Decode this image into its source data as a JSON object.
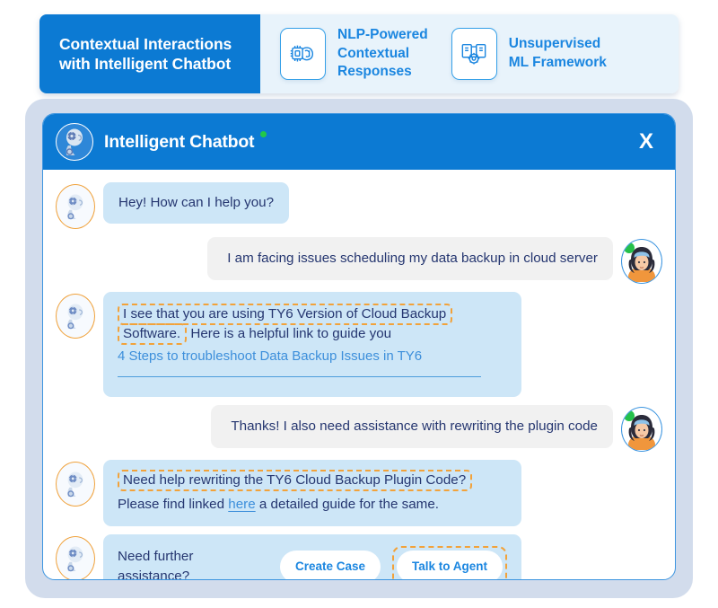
{
  "banner": {
    "title": "Contextual\nInteractions with\nIntelligent Chatbot",
    "features": [
      {
        "icon": "ai-chip-brain-icon",
        "label": "NLP-Powered\nContextual\nResponses"
      },
      {
        "icon": "ml-gear-framework-icon",
        "label": "Unsupervised\nML Framework"
      }
    ]
  },
  "chat": {
    "header": {
      "avatar": "robot-head-icon",
      "title": "Intelligent Chatbot",
      "status": "online",
      "close_label": "X"
    },
    "messages": [
      {
        "id": "m1",
        "sender": "bot",
        "text": "Hey! How can I help you?"
      },
      {
        "id": "m2",
        "sender": "user",
        "text": "I am facing issues scheduling my data backup in cloud server"
      },
      {
        "id": "m3",
        "sender": "bot",
        "highlight": "I see that you are using TY6 Version of Cloud Backup Software.",
        "text": " Here is a helpful link to guide you",
        "link": "4 Steps to troubleshoot Data Backup Issues in TY6"
      },
      {
        "id": "m4",
        "sender": "user",
        "text": "Thanks! I also need assistance with rewriting the plugin code"
      },
      {
        "id": "m5",
        "sender": "bot",
        "highlight": "Need help rewriting the TY6 Cloud Backup Plugin Code?",
        "text_before": "Please find linked ",
        "inline_link": "here",
        "text_after": " a detailed guide for the same."
      },
      {
        "id": "m6",
        "sender": "bot",
        "text": "Need further assistance?",
        "buttons": [
          {
            "label": "Create Case",
            "highlighted": false
          },
          {
            "label": "Talk to Agent",
            "highlighted": true
          }
        ]
      }
    ]
  },
  "colors": {
    "brand_blue": "#0c7ad3",
    "accent_blue": "#1b86e0",
    "bot_bubble": "#cde6f7",
    "user_bubble": "#f1f1f1",
    "text_navy": "#253670",
    "highlight_orange": "#f2a23a",
    "status_green": "#25c04a",
    "panel_gray": "#d2dcec"
  }
}
